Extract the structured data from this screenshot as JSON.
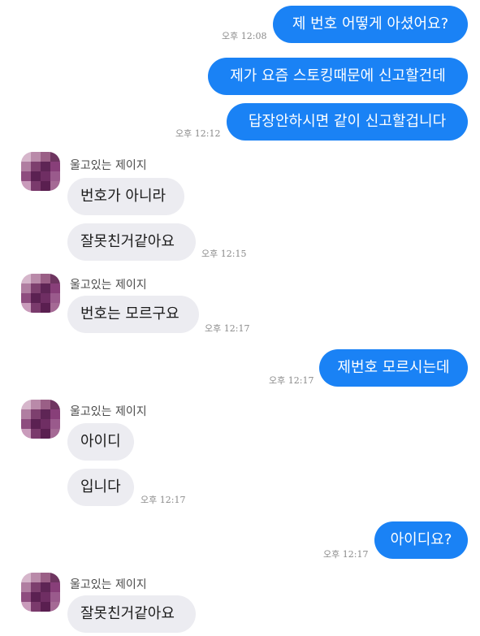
{
  "contact": {
    "name": "울고있는 제이지"
  },
  "messages": [
    {
      "sender": "me",
      "text": "제 번호 어떻게 아셨어요?"
    },
    {
      "sender": "me",
      "text": "제가 요즘 스토킹때문에 신고할건데"
    },
    {
      "sender": "me",
      "text": "답장안하시면 같이 신고할겁니다"
    },
    {
      "sender": "them",
      "text": "번호가 아니라"
    },
    {
      "sender": "them",
      "text": "잘못친거같아요"
    },
    {
      "sender": "them",
      "text": "번호는 모르구요"
    },
    {
      "sender": "me",
      "text": "제번호 모르시는데"
    },
    {
      "sender": "them",
      "text": "아이디"
    },
    {
      "sender": "them",
      "text": "입니다"
    },
    {
      "sender": "me",
      "text": "아이디요?"
    },
    {
      "sender": "them",
      "text": "잘못친거같아요"
    }
  ],
  "timestamps": [
    "오후 12:08",
    "오후 12:12",
    "오후 12:15",
    "오후 12:17",
    "오후 12:17",
    "오후 12:17",
    "오후 12:17"
  ],
  "avatar_pixels": [
    "#d6b6cb",
    "#b98aa9",
    "#9a5f86",
    "#6e3560",
    "#b07ea1",
    "#7d3f6e",
    "#5e2555",
    "#883f79",
    "#8e4d7f",
    "#5b2152",
    "#6f2e63",
    "#9a5a8c",
    "#c99bbb",
    "#7a3a6c",
    "#5a1f50",
    "#a56a95"
  ],
  "colors": {
    "outgoing": "#1a82f5",
    "incoming": "#ececf1",
    "background": "#ffffff"
  }
}
